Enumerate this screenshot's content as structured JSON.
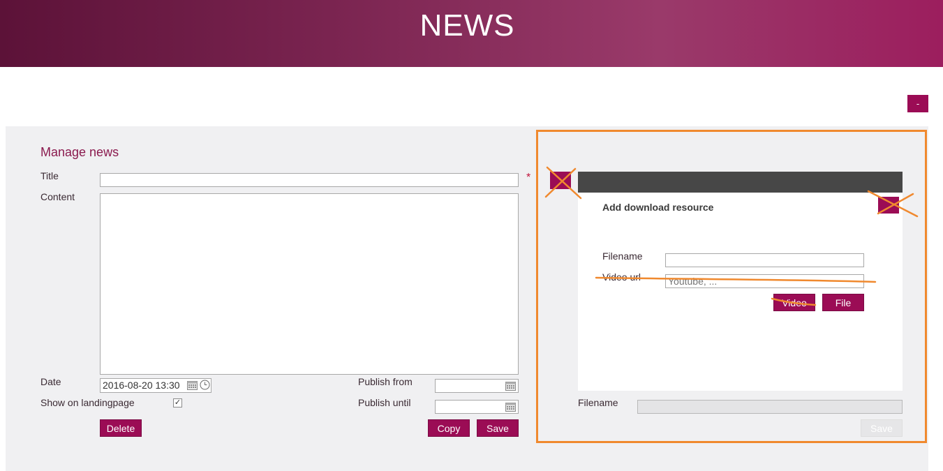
{
  "header": {
    "title": "NEWS"
  },
  "collapse_button": {
    "label": "-"
  },
  "manage": {
    "title": "Manage news",
    "title_label": "Title",
    "title_value": "",
    "required_mark": "*",
    "content_label": "Content",
    "date_label": "Date",
    "date_value": "2016-08-20 13:30",
    "show_on_landing_label": "Show on landingpage",
    "show_on_landing_checked": true,
    "checkbox_mark": "✓",
    "publish_from_label": "Publish from",
    "publish_until_label": "Publish until",
    "delete_label": "Delete",
    "copy_label": "Copy",
    "save_label": "Save"
  },
  "resource": {
    "dialog_title": "Add download resource",
    "filename_label": "Filename",
    "video_url_label": "Video url",
    "video_url_placeholder": "Youtube, ...",
    "video_button": "Video",
    "file_button": "File",
    "bottom_filename_label": "Filename",
    "bottom_save_label": "Save"
  },
  "colors": {
    "accent": "#9b0c55",
    "annotation": "#f0892e",
    "panel_bg": "#f0f0f2",
    "dialog_bar": "#474747"
  }
}
